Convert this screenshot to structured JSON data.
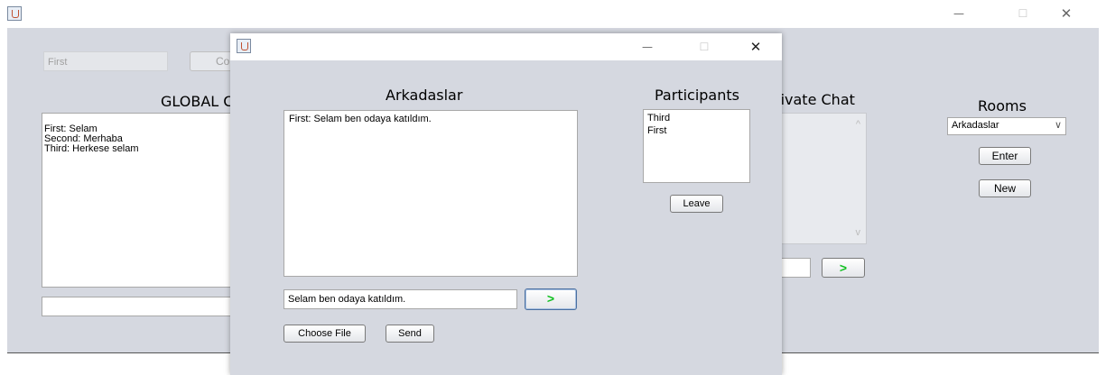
{
  "main_window": {
    "title_bar": {
      "app_icon": "java-cup-icon",
      "minimize_label": "—",
      "maximize_label": "☐",
      "close_label": "✕"
    },
    "global": {
      "name_input_value": "First",
      "connect_button_label": "Con",
      "title": "GLOBAL C",
      "messages": [
        "First: Selam",
        "Second: Merhaba",
        "Third: Herkese selam"
      ],
      "input_value": ""
    },
    "private": {
      "title": "rivate Chat",
      "scroll_up_label": "^",
      "scroll_down_label": "v",
      "input_value": "",
      "send_label": ">"
    },
    "rooms": {
      "title": "Rooms",
      "selected_room": "Arkadaslar",
      "chevron_label": "∨",
      "enter_label": "Enter",
      "new_label": "New"
    }
  },
  "room_dialog": {
    "title_bar": {
      "app_icon": "java-cup-icon",
      "minimize_label": "—",
      "maximize_label": "☐",
      "close_label": "✕"
    },
    "room_name": "Arkadaslar",
    "messages": [
      "First: Selam ben odaya katıldım."
    ],
    "input_value": "Selam ben odaya katıldım.",
    "send_arrow_label": ">",
    "choose_file_label": "Choose File",
    "send_label": "Send",
    "participants_title": "Participants",
    "participants": [
      "Third",
      "First"
    ],
    "leave_label": "Leave"
  },
  "colors": {
    "panel_background": "#d5d8e0",
    "send_arrow": "#10c020"
  }
}
